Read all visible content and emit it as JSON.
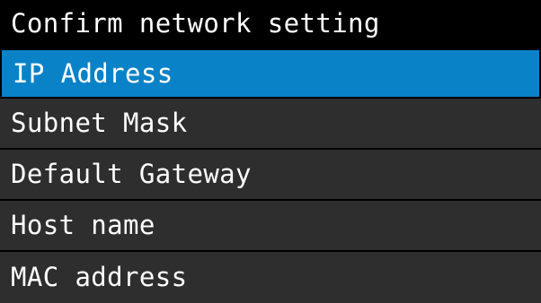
{
  "header": {
    "title": "Confirm network setting"
  },
  "menu": {
    "selected_index": 0,
    "items": [
      {
        "label": "IP Address"
      },
      {
        "label": "Subnet Mask"
      },
      {
        "label": "Default Gateway"
      },
      {
        "label": "Host name"
      },
      {
        "label": "MAC address"
      }
    ]
  },
  "colors": {
    "title_background": "#000000",
    "menu_background": "#2e2e2e",
    "selected_background": "#0a82c8",
    "text": "#ffffff"
  }
}
